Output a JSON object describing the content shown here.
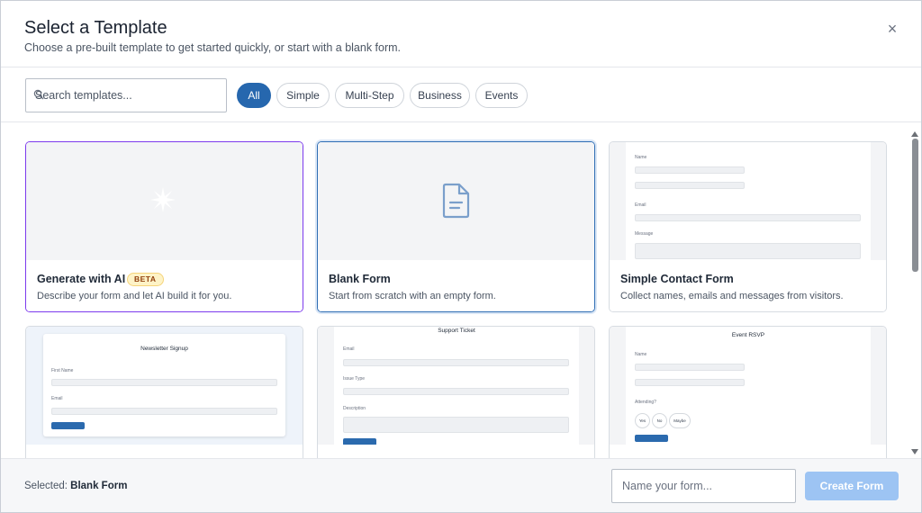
{
  "header": {
    "title": "Select a Template",
    "subtitle": "Choose a pre-built template to get started quickly, or start with a blank form.",
    "close_glyph": "×"
  },
  "search": {
    "placeholder": "Search templates...",
    "value": ""
  },
  "filters": [
    {
      "label": "All",
      "active": true
    },
    {
      "label": "Simple",
      "active": false
    },
    {
      "label": "Multi-Step",
      "active": false
    },
    {
      "label": "Business",
      "active": false
    },
    {
      "label": "Events",
      "active": false
    }
  ],
  "cards": [
    {
      "name": "Generate with AI",
      "badge": "BETA",
      "desc": "Describe your form and let AI build it for you.",
      "icon": "sparkle-icon"
    },
    {
      "name": "Blank Form",
      "desc": "Start from scratch with an empty form.",
      "icon": "document-icon",
      "selected": true
    },
    {
      "name": "Simple Contact Form",
      "desc": "Collect names, emails and messages from visitors.",
      "preview": {
        "labels": [
          "Name",
          "Email",
          "Message"
        ]
      }
    },
    {
      "preview": {
        "title": "Newsletter Signup",
        "labels": [
          "First Name",
          "Email"
        ]
      }
    },
    {
      "preview": {
        "title": "Support Ticket",
        "labels": [
          "Email",
          "Issue Type",
          "Description"
        ]
      }
    },
    {
      "preview": {
        "title": "Event RSVP",
        "labels": [
          "Name",
          "Attending?"
        ],
        "options": [
          "Yes",
          "No",
          "Maybe"
        ]
      }
    }
  ],
  "footer": {
    "selected_label": "Selected:",
    "selected_value": "Blank Form",
    "name_placeholder": "Name your form...",
    "create_label": "Create Form"
  },
  "colors": {
    "accent": "#2667ae",
    "ai_gradient_start": "#5b3fe0",
    "ai_gradient_end": "#a24ff6",
    "beta_bg": "#fef3c7",
    "create_disabled": "#9dc4f3"
  }
}
